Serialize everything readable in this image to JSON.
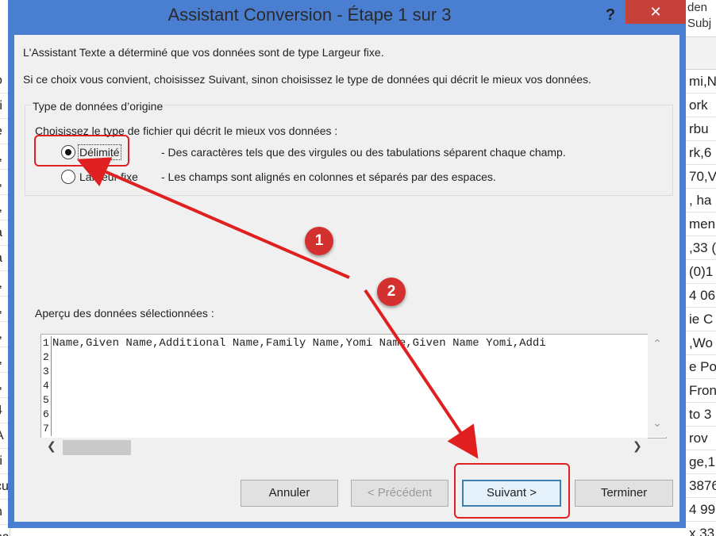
{
  "dialog": {
    "title": "Assistant Conversion - Étape 1 sur 3",
    "help_label": "?",
    "close_label": "✕",
    "intro_line1": "L'Assistant Texte a déterminé que vos données sont de type Largeur fixe.",
    "intro_line2": "Si ce choix vous convient, choisissez Suivant, sinon choisissez le type de données qui décrit le mieux vos données.",
    "group_title": "Type de données d’origine",
    "choose_label": "Choisissez le type de fichier qui décrit le mieux vos données :",
    "options": [
      {
        "label": "Délimité",
        "description": "- Des caractères tels que des virgules ou des tabulations séparent chaque champ.",
        "checked": true
      },
      {
        "label": "Largeur fixe",
        "description": "- Les champs sont alignés en colonnes et séparés par des espaces.",
        "checked": false
      }
    ],
    "preview_label": "Aperçu des données sélectionnées :",
    "preview_line_numbers": [
      "1",
      "2",
      "3",
      "4",
      "5",
      "6",
      "7"
    ],
    "preview_first_row": "Name,Given Name,Additional Name,Family Name,Yomi Name,Given Name Yomi,Addi",
    "buttons": {
      "cancel": "Annuler",
      "previous": "< Précédent",
      "next": "Suivant >",
      "finish": "Terminer"
    }
  },
  "annotations": {
    "badge1": "1",
    "badge2": "2",
    "color": "#e02020"
  },
  "background": {
    "top_right_lines": [
      "den",
      "Subj"
    ],
    "right_cells": [
      "mi,Na",
      "ork",
      "rbu",
      "rk,6",
      "70,V",
      ", ha",
      "men",
      ",33 (",
      "(0)1",
      "4 06",
      "ie C",
      ",Wo",
      "e Po",
      "Fron",
      "to 3",
      "rov",
      "ge,1",
      "3876",
      "4 99",
      "x,33"
    ],
    "left_cells": [
      "o",
      "ri",
      "e",
      ",,",
      ",,",
      ",,",
      "a",
      "a",
      ",,",
      ",,",
      ",,",
      ",,",
      ",,",
      "4",
      "A",
      "ri",
      "cu",
      "n",
      "ec"
    ]
  }
}
